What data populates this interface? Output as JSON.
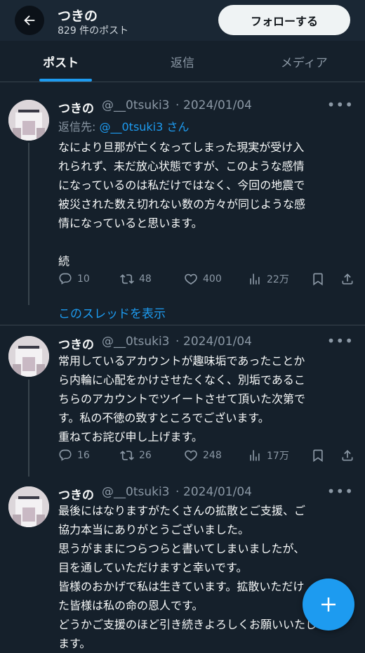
{
  "header": {
    "title": "つきの",
    "subtitle": "829 件のポスト",
    "follow_label": "フォローする"
  },
  "tabs": [
    {
      "label": "ポスト",
      "active": true
    },
    {
      "label": "返信",
      "active": false
    },
    {
      "label": "メディア",
      "active": false
    }
  ],
  "posts": [
    {
      "name": "つきの",
      "handle": "@__0tsuki3",
      "sep": "·",
      "date": "2024/01/04",
      "reply_prefix": "返信先: ",
      "reply_handle": "@__0tsuki3",
      "reply_suffix": " さん",
      "text": "なにより旦那が亡くなってしまった現実が受け入\nれられず、未だ放心状態ですが、このような感情\nになっているのは私だけではなく、今回の地震で\n被災された数え切れない数の方々が同じような感\n情になっていると思います。\n\n続",
      "replies": "10",
      "reposts": "48",
      "likes": "400",
      "views": "22万"
    },
    {
      "name": "つきの",
      "handle": "@__0tsuki3",
      "sep": "·",
      "date": "2024/01/04",
      "text": "常用しているアカウントが趣味垢であったことか\nら内輪に心配をかけさせたくなく、別垢であるこ\nちらのアカウントでツイートさせて頂いた次第で\nす。私の不徳の致すところでございます。\n重ねてお詫び申し上げます。",
      "replies": "16",
      "reposts": "26",
      "likes": "248",
      "views": "17万"
    },
    {
      "name": "つきの",
      "handle": "@__0tsuki3",
      "sep": "·",
      "date": "2024/01/04",
      "text": "最後にはなりますがたくさんの拡散とご支援、ご\n協力本当にありがとうございました。\n思うがままにつらつらと書いてしまいましたが、\n目を通していただけますと幸いです。\n皆様のおかげで私は生きています。拡散いただけ\nた皆様は私の命の恩人です。\nどうかご支援のほど引き続きよろしくお願いいたし\nます。"
    }
  ],
  "show_thread_label": "このスレッドを表示",
  "icons": {
    "back": "arrow-left-icon",
    "more": "more-dots-icon",
    "reply": "reply-icon",
    "repost": "repost-icon",
    "like": "heart-icon",
    "views": "views-icon",
    "bookmark": "bookmark-icon",
    "share": "share-icon",
    "compose": "plus-icon"
  },
  "colors": {
    "background": "#15202b",
    "accent": "#1d9bf0",
    "text_secondary": "#8b98a5"
  }
}
